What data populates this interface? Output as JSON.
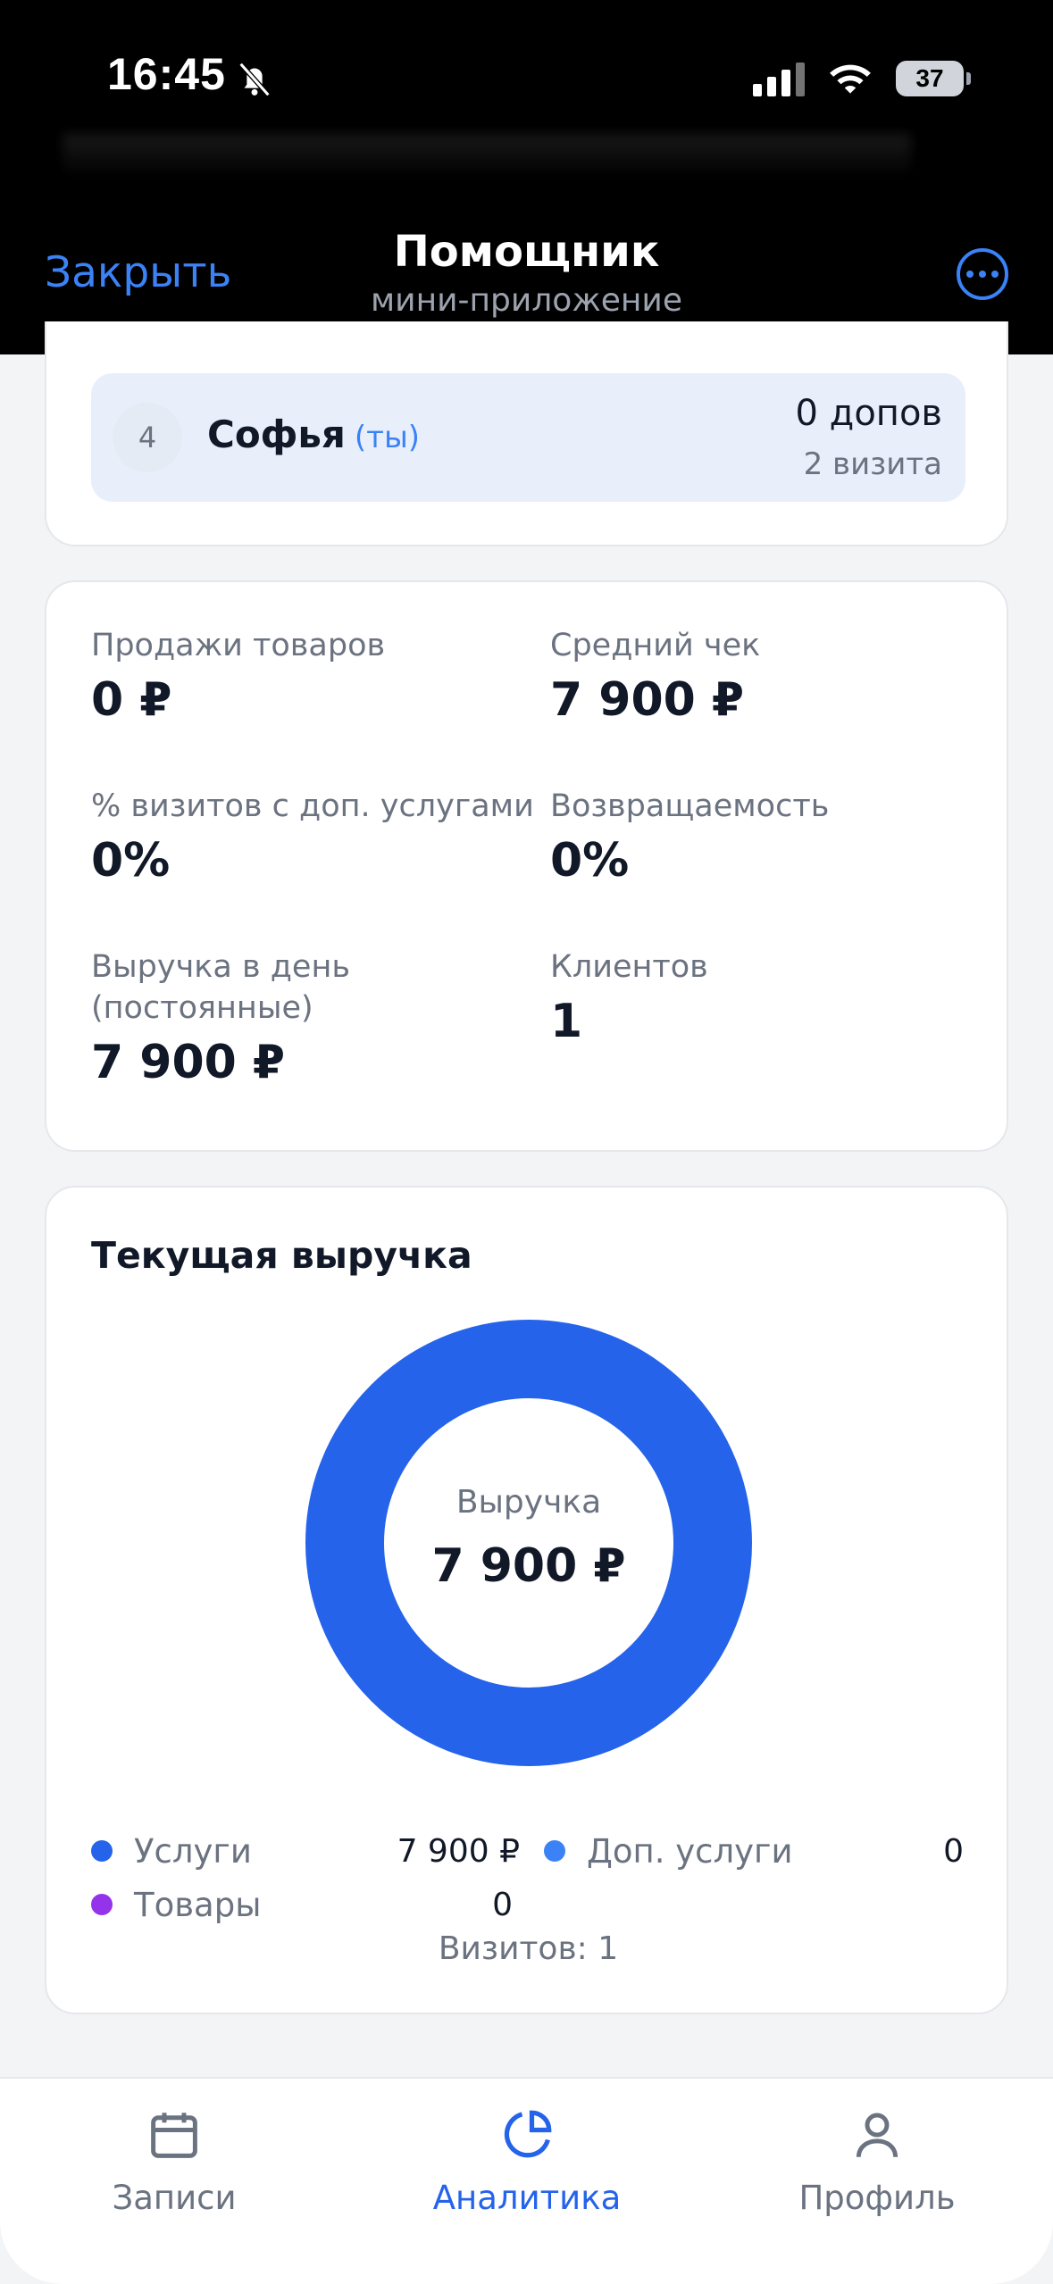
{
  "status_bar": {
    "time": "16:45",
    "battery": "37"
  },
  "header": {
    "close_label": "Закрыть",
    "title": "Помощник",
    "subtitle": "мини-приложение"
  },
  "leaderboard_row": {
    "rank": "4",
    "name": "Софья",
    "you_tag": "(ты)",
    "extras": "0 допов",
    "visits": "2 визита"
  },
  "stats": {
    "product_sales": {
      "label": "Продажи товаров",
      "value": "0 ₽"
    },
    "avg_check": {
      "label": "Средний чек",
      "value": "7 900 ₽"
    },
    "visits_with_extras": {
      "label": "% визитов с доп. услугами",
      "value": "0%"
    },
    "retention": {
      "label": "Возвращаемость",
      "value": "0%"
    },
    "revenue_per_day": {
      "label_line1": "Выручка в день",
      "label_line2": "(постоянные)",
      "value": "7 900 ₽"
    },
    "clients": {
      "label": "Клиентов",
      "value": "1"
    }
  },
  "revenue": {
    "title": "Текущая выручка",
    "center_label": "Выручка",
    "center_value": "7 900 ₽",
    "legend": [
      {
        "name": "Услуги",
        "value": "7 900 ₽",
        "color": "#2563eb"
      },
      {
        "name": "Доп. услуги",
        "value": "0",
        "color": "#3b82f6"
      },
      {
        "name": "Товары",
        "value": "0",
        "color": "#9333ea"
      }
    ],
    "visits_text": "Визитов: 1"
  },
  "chart_data": {
    "type": "pie",
    "title": "Текущая выручка",
    "categories": [
      "Услуги",
      "Доп. услуги",
      "Товары"
    ],
    "values": [
      7900,
      0,
      0
    ],
    "colors": [
      "#2563eb",
      "#3b82f6",
      "#9333ea"
    ]
  },
  "bottom_nav": {
    "items": [
      {
        "label": "Записи",
        "icon": "calendar-icon"
      },
      {
        "label": "Аналитика",
        "icon": "pie-chart-icon",
        "active": true
      },
      {
        "label": "Профиль",
        "icon": "user-icon"
      }
    ]
  }
}
